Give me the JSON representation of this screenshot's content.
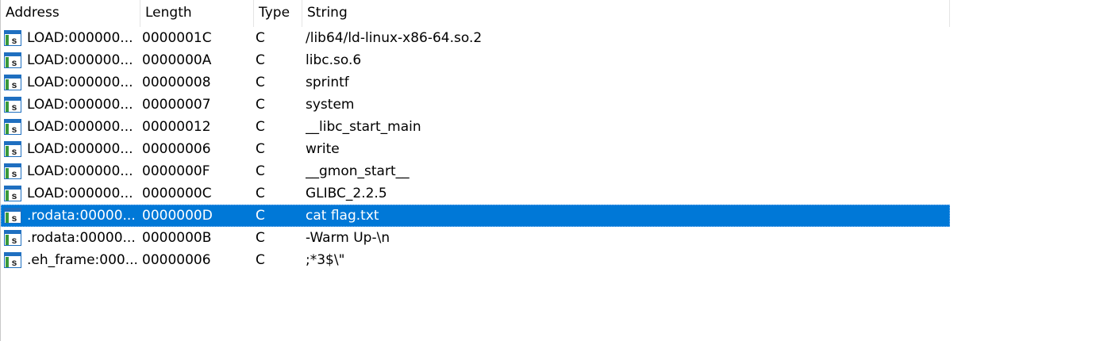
{
  "columns": {
    "address": "Address",
    "length": "Length",
    "type": "Type",
    "string": "String"
  },
  "icon": "string-literal-icon",
  "selected_row": 8,
  "colors": {
    "selection": "#0078d7",
    "icon_blue": "#1f6fc0",
    "icon_green": "#3a9a3a"
  },
  "rows": [
    {
      "address": "LOAD:000000...",
      "length": "0000001C",
      "type": "C",
      "string": "/lib64/ld-linux-x86-64.so.2"
    },
    {
      "address": "LOAD:000000...",
      "length": "0000000A",
      "type": "C",
      "string": "libc.so.6"
    },
    {
      "address": "LOAD:000000...",
      "length": "00000008",
      "type": "C",
      "string": "sprintf"
    },
    {
      "address": "LOAD:000000...",
      "length": "00000007",
      "type": "C",
      "string": "system"
    },
    {
      "address": "LOAD:000000...",
      "length": "00000012",
      "type": "C",
      "string": "__libc_start_main"
    },
    {
      "address": "LOAD:000000...",
      "length": "00000006",
      "type": "C",
      "string": "write"
    },
    {
      "address": "LOAD:000000...",
      "length": "0000000F",
      "type": "C",
      "string": "__gmon_start__"
    },
    {
      "address": "LOAD:000000...",
      "length": "0000000C",
      "type": "C",
      "string": "GLIBC_2.2.5"
    },
    {
      "address": ".rodata:00000...",
      "length": "0000000D",
      "type": "C",
      "string": "cat flag.txt"
    },
    {
      "address": ".rodata:00000...",
      "length": "0000000B",
      "type": "C",
      "string": "-Warm Up-\\n"
    },
    {
      "address": ".eh_frame:000...",
      "length": "00000006",
      "type": "C",
      "string": ";*3$\\\""
    }
  ]
}
